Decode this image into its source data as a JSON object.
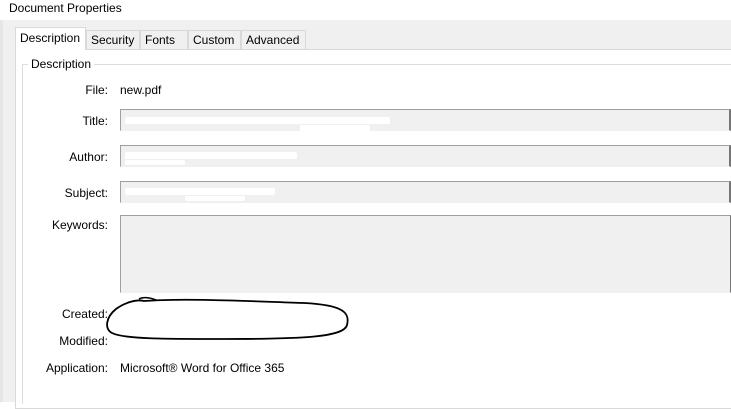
{
  "window": {
    "title": "Document Properties"
  },
  "tabs": [
    {
      "label": "Description",
      "active": true
    },
    {
      "label": "Security",
      "active": false
    },
    {
      "label": "Fonts",
      "active": false
    },
    {
      "label": "Custom",
      "active": false
    },
    {
      "label": "Advanced",
      "active": false
    }
  ],
  "description": {
    "group_label": "Description",
    "file_label": "File:",
    "file_value": "new.pdf",
    "title_label": "Title:",
    "author_label": "Author:",
    "subject_label": "Subject:",
    "keywords_label": "Keywords:",
    "created_label": "Created:",
    "modified_label": "Modified:",
    "application_label": "Application:",
    "application_value": "Microsoft® Word for Office 365"
  },
  "colors": {
    "dialog_bg": "#f0f0f0",
    "panel_bg": "#ffffff",
    "field_bg": "#f0f0f0"
  }
}
